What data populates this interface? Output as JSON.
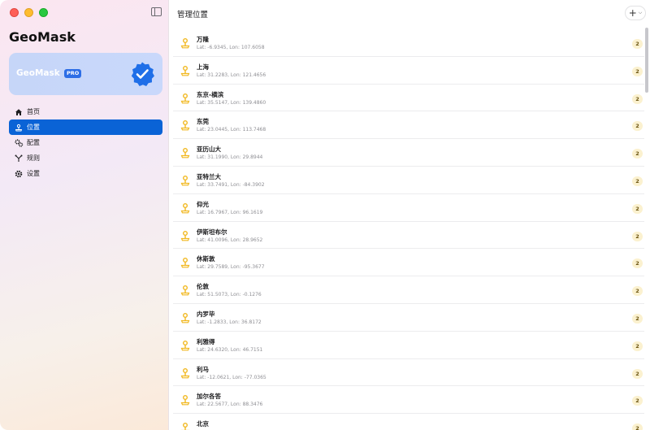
{
  "window": {
    "controls": [
      "close",
      "minimize",
      "maximize"
    ]
  },
  "sidebar": {
    "app_title": "GeoMask",
    "pro_card": {
      "name": "GeoMask",
      "badge": "PRO",
      "icon": "verified-badge-icon",
      "accent": "#2d6ee6"
    },
    "items": [
      {
        "label": "首页",
        "icon": "home-icon",
        "active": false
      },
      {
        "label": "位置",
        "icon": "location-pin-icon",
        "active": true
      },
      {
        "label": "配置",
        "icon": "gears-icon",
        "active": false
      },
      {
        "label": "规则",
        "icon": "branch-icon",
        "active": false
      },
      {
        "label": "设置",
        "icon": "gear-icon",
        "active": false
      }
    ],
    "active_color": "#0a63d6"
  },
  "main": {
    "title": "管理位置",
    "add_button": {
      "label": "+",
      "icon": "plus-icon"
    },
    "locations": [
      {
        "name": "万隆",
        "coords": "Lat: -6.9345, Lon: 107.6058",
        "count": "2"
      },
      {
        "name": "上海",
        "coords": "Lat: 31.2283, Lon: 121.4656",
        "count": "2"
      },
      {
        "name": "东京-横滨",
        "coords": "Lat: 35.5147, Lon: 139.4860",
        "count": "2"
      },
      {
        "name": "东莞",
        "coords": "Lat: 23.0445, Lon: 113.7468",
        "count": "2"
      },
      {
        "name": "亚历山大",
        "coords": "Lat: 31.1990, Lon: 29.8944",
        "count": "2"
      },
      {
        "name": "亚特兰大",
        "coords": "Lat: 33.7491, Lon: -84.3902",
        "count": "2"
      },
      {
        "name": "仰光",
        "coords": "Lat: 16.7967, Lon: 96.1619",
        "count": "2"
      },
      {
        "name": "伊斯坦布尔",
        "coords": "Lat: 41.0096, Lon: 28.9652",
        "count": "2"
      },
      {
        "name": "休斯敦",
        "coords": "Lat: 29.7589, Lon: -95.3677",
        "count": "2"
      },
      {
        "name": "伦敦",
        "coords": "Lat: 51.5073, Lon: -0.1276",
        "count": "2"
      },
      {
        "name": "内罗毕",
        "coords": "Lat: -1.2833, Lon: 36.8172",
        "count": "2"
      },
      {
        "name": "利雅得",
        "coords": "Lat: 24.6320, Lon: 46.7151",
        "count": "2"
      },
      {
        "name": "利马",
        "coords": "Lat: -12.0621, Lon: -77.0365",
        "count": "2"
      },
      {
        "name": "加尔各答",
        "coords": "Lat: 22.5677, Lon: 88.3476",
        "count": "2"
      },
      {
        "name": "北京",
        "coords": "",
        "count": "2"
      }
    ]
  }
}
